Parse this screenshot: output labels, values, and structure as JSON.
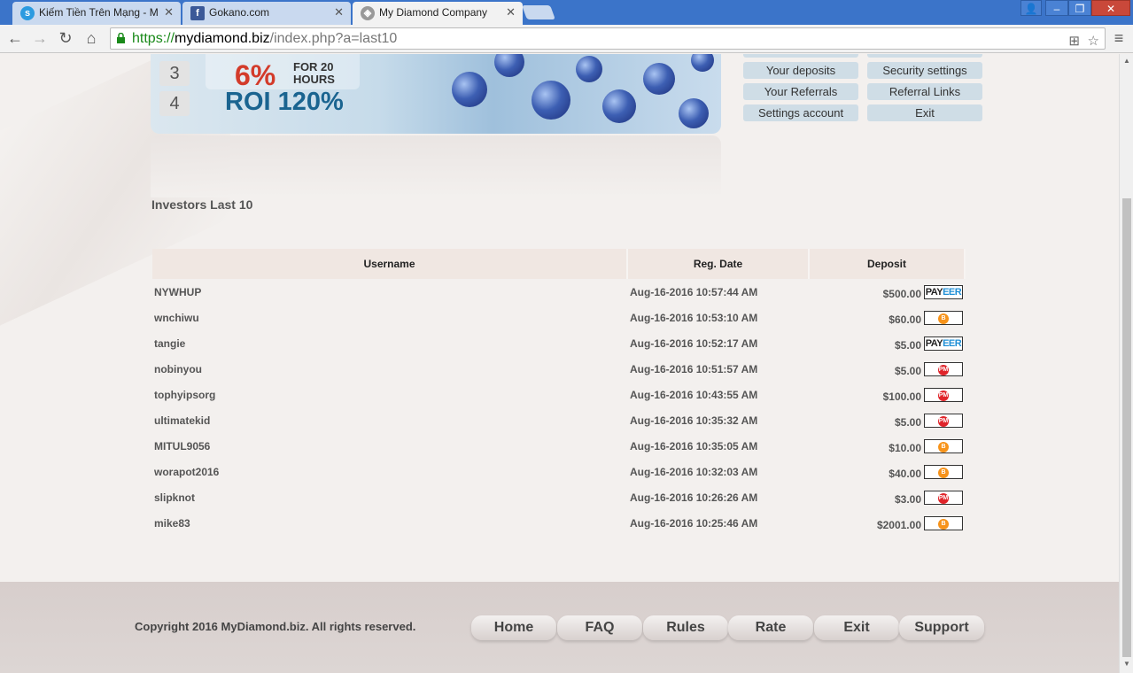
{
  "browser": {
    "tabs": [
      {
        "title": "Kiếm Tiền Trên Mạng - M",
        "icon": "s"
      },
      {
        "title": "Gokano.com",
        "icon": "f"
      },
      {
        "title": "My Diamond Company",
        "icon": "◈"
      }
    ],
    "url_scheme": "https://",
    "url_host": "mydiamond.biz",
    "url_path": "/index.php?a=last10"
  },
  "banner": {
    "steps": [
      "3",
      "4"
    ],
    "percent": "6%",
    "hours_line1": "FOR 20",
    "hours_line2": "HOURS",
    "roi": "ROI 120%"
  },
  "account_menu": {
    "your_deposits": "Your deposits",
    "security_settings": "Security settings",
    "your_referrals": "Your Referrals",
    "referral_links": "Referral Links",
    "settings_account": "Settings account",
    "exit": "Exit"
  },
  "main": {
    "title": "Investors Last 10",
    "columns": [
      "Username",
      "Reg. Date",
      "Deposit"
    ],
    "rows": [
      {
        "username": "NYWHUP",
        "date": "Aug-16-2016 10:57:44 AM",
        "deposit": "$500.00",
        "method": "payeer"
      },
      {
        "username": "wnchiwu",
        "date": "Aug-16-2016 10:53:10 AM",
        "deposit": "$60.00",
        "method": "bitcoin"
      },
      {
        "username": "tangie",
        "date": "Aug-16-2016 10:52:17 AM",
        "deposit": "$5.00",
        "method": "payeer"
      },
      {
        "username": "nobinyou",
        "date": "Aug-16-2016 10:51:57 AM",
        "deposit": "$5.00",
        "method": "perfectmoney"
      },
      {
        "username": "tophyipsorg",
        "date": "Aug-16-2016 10:43:55 AM",
        "deposit": "$100.00",
        "method": "perfectmoney"
      },
      {
        "username": "ultimatekid",
        "date": "Aug-16-2016 10:35:32 AM",
        "deposit": "$5.00",
        "method": "perfectmoney"
      },
      {
        "username": "MITUL9056",
        "date": "Aug-16-2016 10:35:05 AM",
        "deposit": "$10.00",
        "method": "bitcoin"
      },
      {
        "username": "worapot2016",
        "date": "Aug-16-2016 10:32:03 AM",
        "deposit": "$40.00",
        "method": "bitcoin"
      },
      {
        "username": "slipknot",
        "date": "Aug-16-2016 10:26:26 AM",
        "deposit": "$3.00",
        "method": "perfectmoney"
      },
      {
        "username": "mike83",
        "date": "Aug-16-2016 10:25:46 AM",
        "deposit": "$2001.00",
        "method": "bitcoin"
      }
    ]
  },
  "footer": {
    "copyright": "Copyright 2016 MyDiamond.biz. All rights reserved.",
    "nav": [
      "Home",
      "FAQ",
      "Rules",
      "Rate",
      "Exit",
      "Support"
    ]
  },
  "payment_labels": {
    "payeer_left": "PAY",
    "payeer_right": "EER",
    "bitcoin": "B",
    "perfectmoney": "PM"
  },
  "colors": {
    "chrome_blue": "#3b74c9",
    "url_green": "#1a8a1a",
    "payeer_blue": "#1f8fd6",
    "bitcoin_orange": "#f7931a",
    "pm_red": "#e0242a"
  }
}
